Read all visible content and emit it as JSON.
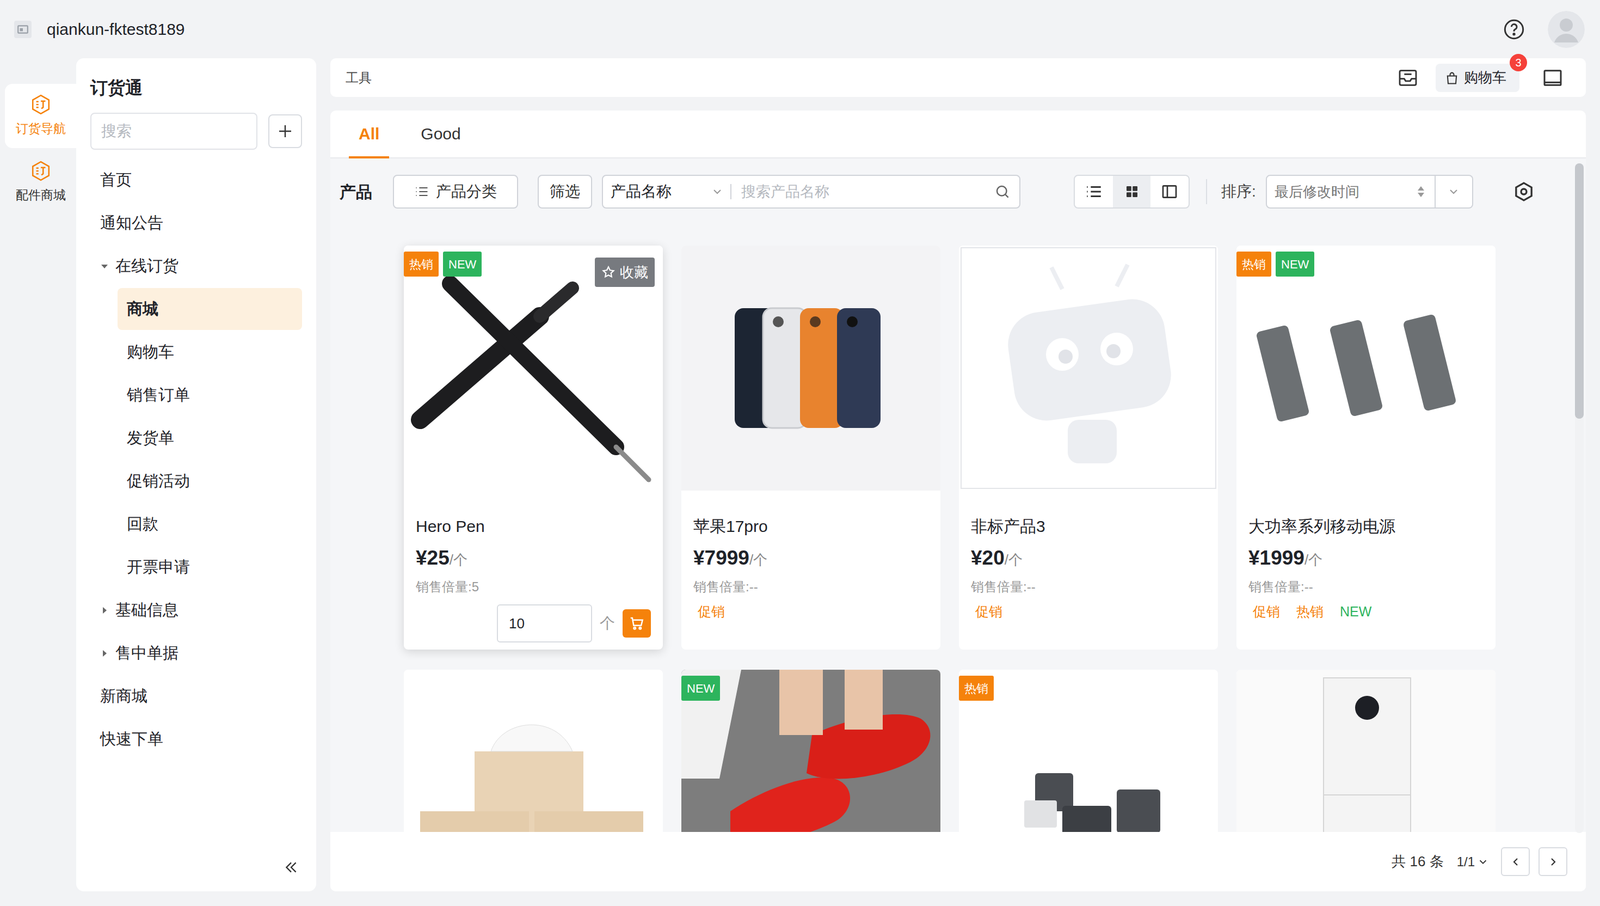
{
  "header": {
    "title": "qiankun-fktest8189"
  },
  "rail": [
    {
      "label": "订货导航",
      "selected": true
    },
    {
      "label": "配件商城",
      "selected": false
    }
  ],
  "sidebar": {
    "title": "订货通",
    "search": {
      "placeholder": "搜索"
    },
    "items": [
      {
        "label": "首页",
        "kind": "link",
        "selected": false
      },
      {
        "label": "通知公告",
        "kind": "link",
        "selected": false
      },
      {
        "label": "在线订货",
        "kind": "group",
        "expanded": true,
        "selected": false
      },
      {
        "label": "商城",
        "kind": "child",
        "selected": true
      },
      {
        "label": "购物车",
        "kind": "child",
        "selected": false
      },
      {
        "label": "销售订单",
        "kind": "child",
        "selected": false
      },
      {
        "label": "发货单",
        "kind": "child",
        "selected": false
      },
      {
        "label": "促销活动",
        "kind": "child",
        "selected": false
      },
      {
        "label": "回款",
        "kind": "child",
        "selected": false
      },
      {
        "label": "开票申请",
        "kind": "child",
        "selected": false
      },
      {
        "label": "基础信息",
        "kind": "group",
        "expanded": false,
        "selected": false
      },
      {
        "label": "售中单据",
        "kind": "group",
        "expanded": false,
        "selected": false
      },
      {
        "label": "新商城",
        "kind": "link",
        "selected": false
      },
      {
        "label": "快速下单",
        "kind": "link",
        "selected": false
      }
    ]
  },
  "toolbar": {
    "title": "工具",
    "cart": {
      "label": "购物车",
      "count": "3"
    }
  },
  "tabs": [
    {
      "label": "All",
      "selected": true
    },
    {
      "label": "Good",
      "selected": false
    }
  ],
  "filters": {
    "title": "产品",
    "category": "产品分类",
    "filter": "筛选",
    "field": "产品名称",
    "search_placeholder": "搜索产品名称",
    "views": [
      {
        "kind": "list",
        "selected": false
      },
      {
        "kind": "grid",
        "selected": true
      },
      {
        "kind": "panel",
        "selected": false
      }
    ],
    "sort_label": "排序:",
    "sort_value": "最后修改时间"
  },
  "products": [
    {
      "name": "Hero Pen",
      "price": "¥25",
      "unit": "/个",
      "multiple": "销售倍量:5",
      "hovered": true,
      "badges": [
        {
          "label": "热销",
          "color": "#f5820b"
        },
        {
          "label": "NEW",
          "color": "#2db45d"
        }
      ],
      "tags": [],
      "favorite": "收藏",
      "quantity": "10",
      "quantity_unit": "个"
    },
    {
      "name": "苹果17pro",
      "price": "¥7999",
      "unit": "/个",
      "multiple": "销售倍量:--",
      "hovered": false,
      "badges": [],
      "tags": [
        {
          "label": "促销",
          "color": "#f5820b"
        }
      ]
    },
    {
      "name": "非标产品3",
      "price": "¥20",
      "unit": "/个",
      "multiple": "销售倍量:--",
      "hovered": false,
      "badges": [],
      "tags": [
        {
          "label": "促销",
          "color": "#f5820b"
        }
      ]
    },
    {
      "name": "大功率系列移动电源",
      "price": "¥1999",
      "unit": "/个",
      "multiple": "销售倍量:--",
      "hovered": false,
      "badges": [
        {
          "label": "热销",
          "color": "#f5820b"
        },
        {
          "label": "NEW",
          "color": "#2db45d"
        }
      ],
      "tags": [
        {
          "label": "促销",
          "color": "#f5820b"
        },
        {
          "label": "热销",
          "color": "#f5820b"
        },
        {
          "label": "NEW",
          "color": "#2db45d"
        }
      ]
    },
    {
      "hovered": false,
      "badges": []
    },
    {
      "hovered": false,
      "badges": [
        {
          "label": "NEW",
          "color": "#2db45d"
        }
      ]
    },
    {
      "hovered": false,
      "badges": [
        {
          "label": "热销",
          "color": "#f5820b"
        }
      ]
    },
    {
      "hovered": false,
      "badges": []
    }
  ],
  "footer": {
    "total": "共 16 条",
    "page": "1/1"
  }
}
